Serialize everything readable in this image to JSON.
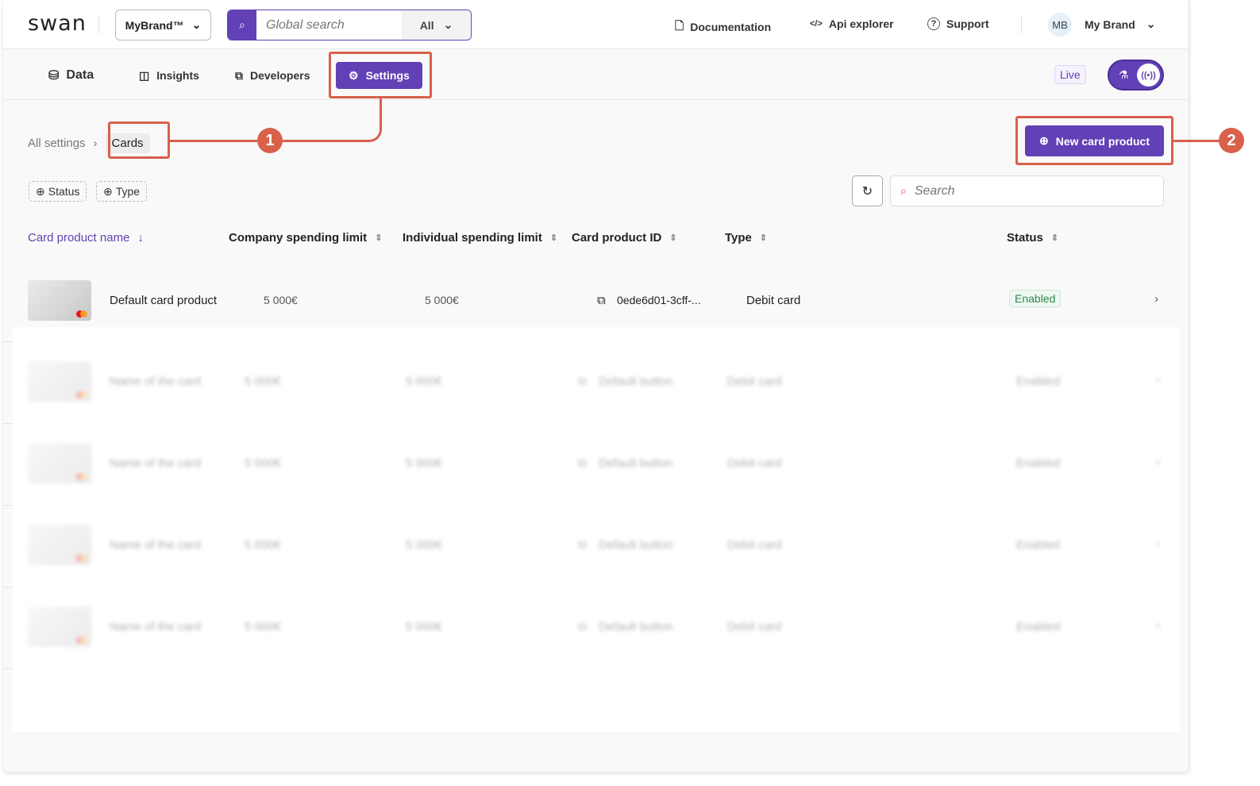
{
  "header": {
    "logo": "swan",
    "brand": "MyBrand™",
    "search_placeholder": "Global search",
    "search_scope": "All",
    "links": [
      {
        "label": "Documentation",
        "icon": "document-icon"
      },
      {
        "label": "Api explorer",
        "icon": "code-icon"
      },
      {
        "label": "Support",
        "icon": "help-icon"
      }
    ],
    "avatar": "MB",
    "account": "My Brand"
  },
  "nav": {
    "tabs": [
      {
        "label": "Data",
        "icon": "database-icon"
      },
      {
        "label": "Insights",
        "icon": "layout-icon"
      },
      {
        "label": "Developers",
        "icon": "developer-icon"
      },
      {
        "label": "Settings",
        "icon": "gear-icon",
        "active": true
      }
    ],
    "mode_label": "Live",
    "mode_live": true
  },
  "breadcrumb": {
    "parent": "All settings",
    "current": "Cards"
  },
  "actions": {
    "new_card_product": "New card product",
    "search_placeholder": "Search"
  },
  "filters": [
    {
      "label": "Status"
    },
    {
      "label": "Type"
    }
  ],
  "table": {
    "columns": [
      "Card product name",
      "Company spending limit",
      "Individual spending limit",
      "Card product ID",
      "Type",
      "Status"
    ],
    "rows": [
      {
        "name": "Default card product",
        "company_limit": "5 000€",
        "individual_limit": "5 000€",
        "id": "0ede6d01-3cff-...",
        "type": "Debit card",
        "status": "Enabled"
      }
    ],
    "placeholder_rows": [
      {
        "name": "Name of the card",
        "company_limit": "5 000€",
        "individual_limit": "5 000€",
        "id": "Default button",
        "type": "Debit card",
        "status": "Enabled"
      },
      {
        "name": "Name of the card",
        "company_limit": "5 000€",
        "individual_limit": "5 000€",
        "id": "Default button",
        "type": "Debit card",
        "status": "Enabled"
      },
      {
        "name": "Name of the card",
        "company_limit": "5 000€",
        "individual_limit": "5 000€",
        "id": "Default button",
        "type": "Debit card",
        "status": "Enabled"
      },
      {
        "name": "Name of the card",
        "company_limit": "5 000€",
        "individual_limit": "5 000€",
        "id": "Default button",
        "type": "Debit card",
        "status": "Enabled"
      }
    ]
  },
  "annotations": [
    "1",
    "2"
  ],
  "colors": {
    "accent": "#6240b5",
    "annotation": "#d9604a",
    "enabled": "#2c8a4e"
  }
}
